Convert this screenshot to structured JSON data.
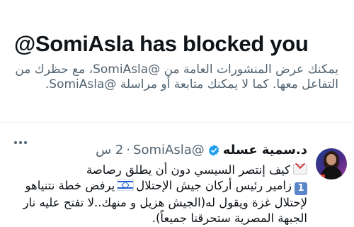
{
  "blocked_notice": {
    "headline": "@SomiAsla has blocked you",
    "description": "يمكنك عرض المنشورات العامة من @SomiAsla، مع حظرك من التفاعل معها. كما لا يمكنك متابعة أو مراسلة @SomiAsla."
  },
  "post": {
    "display_name": "د.سمية عسله",
    "handle": "@SomiAsla",
    "separator": "·",
    "timestamp": "2 س",
    "lines": [
      "كيف إنتصر السيسي دون أن يطلق رصاصة",
      "زامير رئيس أركان جيش الإحتلال",
      "يرفض خطة نتنياهو",
      "لإحتلال غزة ويقول له(الجيش هزيل و منهك..لا تفتح عليه نار",
      "الجبهة المصرية ستحرقنا جميعاً)."
    ],
    "keycap_digit": "1",
    "icons": {
      "verified": "verified-badge-icon",
      "more": "more-options-icon",
      "envelope": "incoming-envelope-icon",
      "flag": "israel-flag-icon"
    },
    "accent_color": "#1d9bf0"
  }
}
